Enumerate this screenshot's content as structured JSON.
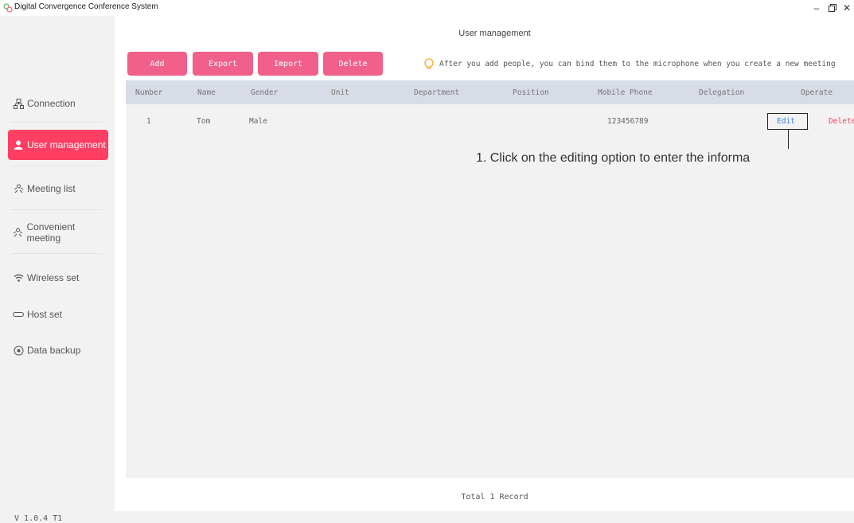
{
  "window": {
    "title": "Digital Convergence Conference System",
    "controls": {
      "minimize": "–",
      "restore": "🗗",
      "close": "✕"
    }
  },
  "sidebar": {
    "items": [
      {
        "label": "Connection",
        "icon": "network-icon",
        "active": false
      },
      {
        "label": "User management",
        "icon": "user-icon",
        "active": true
      },
      {
        "label": "Meeting list",
        "icon": "meeting-icon",
        "active": false
      },
      {
        "label": "Convenient meeting",
        "icon": "meeting-icon",
        "active": false
      },
      {
        "label": "Wireless set",
        "icon": "wifi-icon",
        "active": false
      },
      {
        "label": "Host set",
        "icon": "host-icon",
        "active": false
      },
      {
        "label": "Data backup",
        "icon": "backup-icon",
        "active": false
      }
    ],
    "version": "V 1.0.4 T1"
  },
  "main": {
    "title": "User management",
    "buttons": {
      "add": "Add",
      "export": "Export",
      "import": "Import",
      "delete": "Delete"
    },
    "tip": "After you add people, you can bind them to the microphone when you create a new meeting",
    "table": {
      "columns": [
        "Number",
        "Name",
        "Gender",
        "Unit",
        "Department",
        "Position",
        "Mobile Phone",
        "Delegation",
        "Operate"
      ],
      "rows": [
        {
          "number": "1",
          "name": "Tom",
          "gender": "Male",
          "unit": "",
          "department": "",
          "position": "",
          "mobile": "123456789",
          "delegation": "",
          "edit": "Edit",
          "delete": "Delete"
        }
      ]
    },
    "footer": "Total 1 Record",
    "annotation": "1. Click on the editing option to enter the informa"
  },
  "colors": {
    "accent": "#ff3e63",
    "button": "#f0608b",
    "header_bg": "#d8dce6",
    "edit_link": "#3f7fd8",
    "delete_link": "#e24a5f",
    "tip_icon": "#f5a623"
  }
}
